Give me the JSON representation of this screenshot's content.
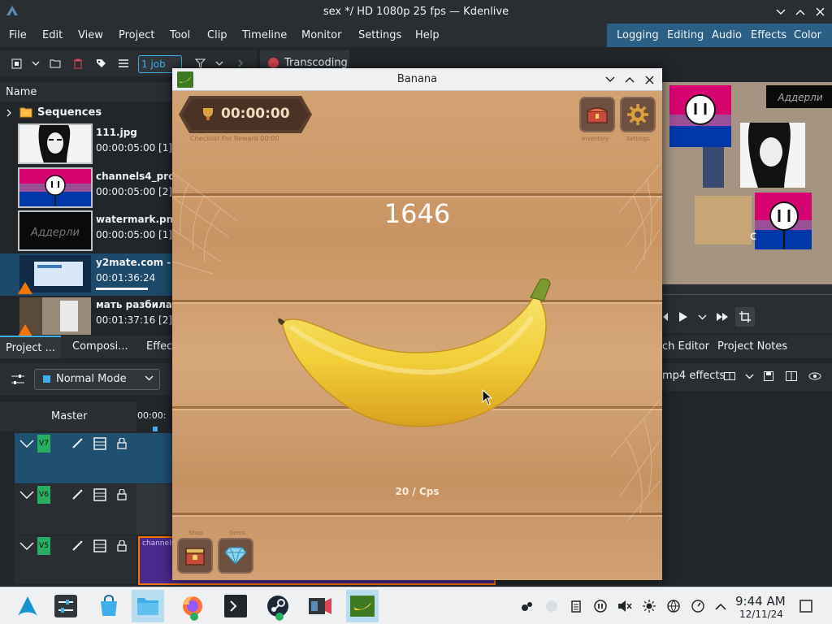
{
  "kdenlive": {
    "window_title": "sex */ HD 1080p 25 fps — Kdenlive",
    "menu": [
      "File",
      "Edit",
      "View",
      "Project",
      "Tool",
      "Clip",
      "Timeline",
      "Monitor",
      "Settings",
      "Help"
    ],
    "layouts": [
      "Logging",
      "Editing",
      "Audio",
      "Effects",
      "Color"
    ],
    "job_combo": "1 job",
    "transcoding_tab": "Transcoding",
    "bin_header": "Name",
    "folder": "Sequences",
    "clips": [
      {
        "name": "111.jpg",
        "duration": "00:00:05:00 [1]"
      },
      {
        "name": "channels4_pro",
        "duration": "00:00:05:00 [2]"
      },
      {
        "name": "watermark.pn",
        "duration": "00:00:05:00 [1]"
      },
      {
        "name": "y2mate.com -",
        "duration": "00:01:36:24"
      },
      {
        "name": "мать разбила",
        "duration": "00:01:37:16 [2]"
      }
    ],
    "left_tabs": [
      "Project ...",
      "Composi...",
      "Effec"
    ],
    "mode_combo": "Normal Mode",
    "master_label": "Master",
    "ruler_time": "00:00:",
    "tracks": [
      "V7",
      "V6",
      "V5"
    ],
    "clip_strip_label": "channels4",
    "right_tabs": [
      "ch Editor",
      "Project Notes"
    ],
    "effect_bar_label": "mp4 effects",
    "monitor_text_overlay": "Аддерли",
    "monitor_text_overlay2": "c"
  },
  "banana_window": {
    "title": "Banana",
    "timer": "00:00:00",
    "timer_caption": "Checklist For Reward 00:00",
    "score": "1646",
    "cps": "20 / Cps",
    "top_buttons": [
      {
        "label": "Inventory",
        "icon": "chest-icon"
      },
      {
        "label": "Settings",
        "icon": "gear-icon"
      }
    ],
    "bottom_buttons": [
      {
        "label": "Shop",
        "icon": "shop-chest-icon"
      },
      {
        "label": "Gems",
        "icon": "diamond-icon"
      }
    ],
    "colors": {
      "banana": "#f2d040",
      "wood": "#cf9c6e"
    }
  },
  "taskbar": {
    "time": "9:44 AM",
    "date": "12/11/24"
  }
}
